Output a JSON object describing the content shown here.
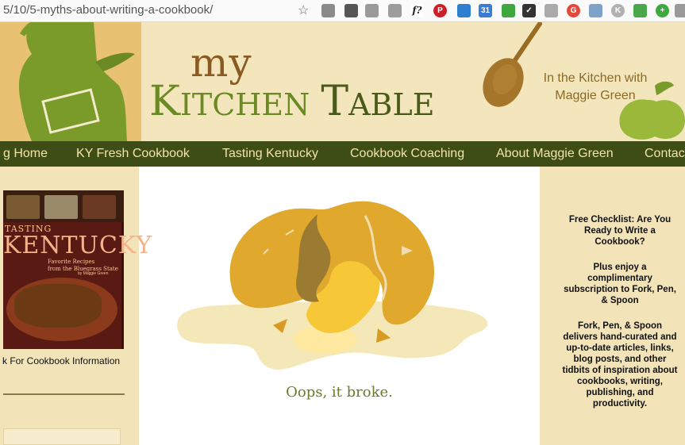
{
  "browser": {
    "url": "5/10/5-myths-about-writing-a-cookbook/",
    "extensions": [
      {
        "name": "dropper-icon",
        "color": "#8a8a8a",
        "glyph": ""
      },
      {
        "name": "evernote-icon",
        "color": "#555555",
        "glyph": ""
      },
      {
        "name": "clipper-icon",
        "color": "#9a9a9a",
        "glyph": ""
      },
      {
        "name": "ghost-icon",
        "color": "#9c9c9c",
        "glyph": ""
      },
      {
        "name": "font-icon",
        "color": "#ffffff",
        "glyph": "f?"
      },
      {
        "name": "pinterest-icon",
        "color": "#cb2027",
        "glyph": "P"
      },
      {
        "name": "analytics-icon",
        "color": "#2f7fd1",
        "glyph": ""
      },
      {
        "name": "calendar-icon",
        "color": "#3a7bd5",
        "glyph": "31"
      },
      {
        "name": "target-icon",
        "color": "#3ea83e",
        "glyph": ""
      },
      {
        "name": "check-icon",
        "color": "#333333",
        "glyph": "✓"
      },
      {
        "name": "grid-icon",
        "color": "#aaaaaa",
        "glyph": ""
      },
      {
        "name": "grammarly-icon",
        "color": "#e2493a",
        "glyph": "G"
      },
      {
        "name": "link-icon",
        "color": "#7ea1c9",
        "glyph": ""
      },
      {
        "name": "klout-icon",
        "color": "#b0b0b0",
        "glyph": "K"
      },
      {
        "name": "bookmark-icon",
        "color": "#4aa84a",
        "glyph": ""
      },
      {
        "name": "add-icon",
        "color": "#3caa3c",
        "glyph": "+"
      },
      {
        "name": "account-icon",
        "color": "#9a9a9a",
        "glyph": ""
      }
    ]
  },
  "header": {
    "logo_my": "my",
    "logo_kitchen": "Kitchen",
    "logo_table": "Table",
    "tagline_line1": "In the Kitchen with",
    "tagline_line2": "Maggie Green"
  },
  "nav": {
    "items": [
      {
        "label": "g Home"
      },
      {
        "label": "KY Fresh Cookbook"
      },
      {
        "label": "Tasting Kentucky"
      },
      {
        "label": "Cookbook Coaching"
      },
      {
        "label": "About Maggie Green"
      },
      {
        "label": "Contac"
      }
    ]
  },
  "left": {
    "book": {
      "title_top": "TASTING",
      "title_main": "KENTUCKY",
      "subtitle_line1": "Favorite Recipes",
      "subtitle_line2": "from the Bluegrass State",
      "author": "by Maggie Green"
    },
    "link": "k For Cookbook Information"
  },
  "main": {
    "message": "Oops, it broke."
  },
  "right": {
    "para1": "Free Checklist: Are You Ready to Write a Cookbook?",
    "para2": "Plus enjoy a complimentary subscription to Fork, Pen, & Spoon",
    "para3": "Fork, Pen, & Spoon delivers hand-curated and up-to-date articles, links, blog posts, and other tidbits of inspiration about cookbooks, writing, publishing, and productivity."
  },
  "colors": {
    "nav_bg": "#3e4d15",
    "nav_text": "#f2e4a8",
    "sidebar_bg": "#f2e3b8",
    "accent_green": "#6b8a24",
    "accent_brown": "#8a5a23",
    "egg_gold": "#e0a92e"
  }
}
